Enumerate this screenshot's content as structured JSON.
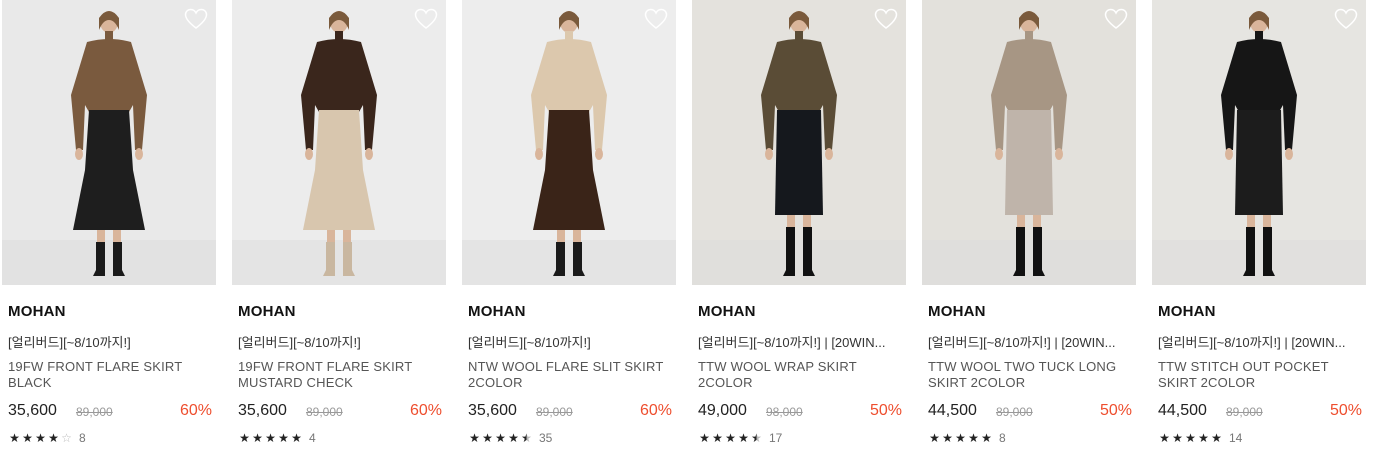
{
  "products": [
    {
      "brand": "MOHAN",
      "promo": "[얼리버드][~8/10까지!]",
      "name": "19FW FRONT FLARE SKIRT BLACK",
      "price": "35,600",
      "original_price": "89,000",
      "discount": "60%",
      "rating": 4,
      "review_count": "8",
      "wishlist_icon": "heart-outline-icon",
      "photo": {
        "bg": "#e9e9e9",
        "top": "#7a5a3e",
        "skirt": "#1e1e1e",
        "boots": "#1a1a1a",
        "skirt_shape": "flare"
      }
    },
    {
      "brand": "MOHAN",
      "promo": "[얼리버드][~8/10까지!]",
      "name": "19FW FRONT FLARE SKIRT MUSTARD CHECK",
      "price": "35,600",
      "original_price": "89,000",
      "discount": "60%",
      "rating": 5,
      "review_count": "4",
      "wishlist_icon": "heart-outline-icon",
      "photo": {
        "bg": "#ececec",
        "top": "#3a261c",
        "skirt": "#d8c6ae",
        "boots": "#c9b7a0",
        "skirt_shape": "flare"
      }
    },
    {
      "brand": "MOHAN",
      "promo": "[얼리버드][~8/10까지!]",
      "name": "NTW WOOL FLARE SLIT SKIRT 2COLOR",
      "price": "35,600",
      "original_price": "89,000",
      "discount": "60%",
      "rating": 4.5,
      "review_count": "35",
      "wishlist_icon": "heart-outline-icon",
      "photo": {
        "bg": "#ededed",
        "top": "#dcc8ad",
        "skirt": "#3a2418",
        "boots": "#1a1a1a",
        "skirt_shape": "flare"
      }
    },
    {
      "brand": "MOHAN",
      "promo": "[얼리버드][~8/10까지!] | [20WIN...",
      "name": "TTW WOOL WRAP SKIRT 2COLOR",
      "price": "49,000",
      "original_price": "98,000",
      "discount": "50%",
      "rating": 4.5,
      "review_count": "17",
      "wishlist_icon": "heart-outline-icon",
      "photo": {
        "bg": "#e4e2dd",
        "top": "#5a4c36",
        "skirt": "#15181d",
        "boots": "#111111",
        "skirt_shape": "straight"
      }
    },
    {
      "brand": "MOHAN",
      "promo": "[얼리버드][~8/10까지!] | [20WIN...",
      "name": "TTW WOOL TWO TUCK LONG SKIRT 2COLOR",
      "price": "44,500",
      "original_price": "89,000",
      "discount": "50%",
      "rating": 5,
      "review_count": "8",
      "wishlist_icon": "heart-outline-icon",
      "photo": {
        "bg": "#e3e1dc",
        "top": "#a79684",
        "skirt": "#bfb4aa",
        "boots": "#111111",
        "skirt_shape": "straight"
      }
    },
    {
      "brand": "MOHAN",
      "promo": "[얼리버드][~8/10까지!] | [20WIN...",
      "name": "TTW STITCH OUT POCKET SKIRT 2COLOR",
      "price": "44,500",
      "original_price": "89,000",
      "discount": "50%",
      "rating": 5,
      "review_count": "14",
      "wishlist_icon": "heart-outline-icon",
      "photo": {
        "bg": "#e6e5e1",
        "top": "#161616",
        "skirt": "#1c1c1c",
        "boots": "#111111",
        "skirt_shape": "straight"
      }
    }
  ]
}
